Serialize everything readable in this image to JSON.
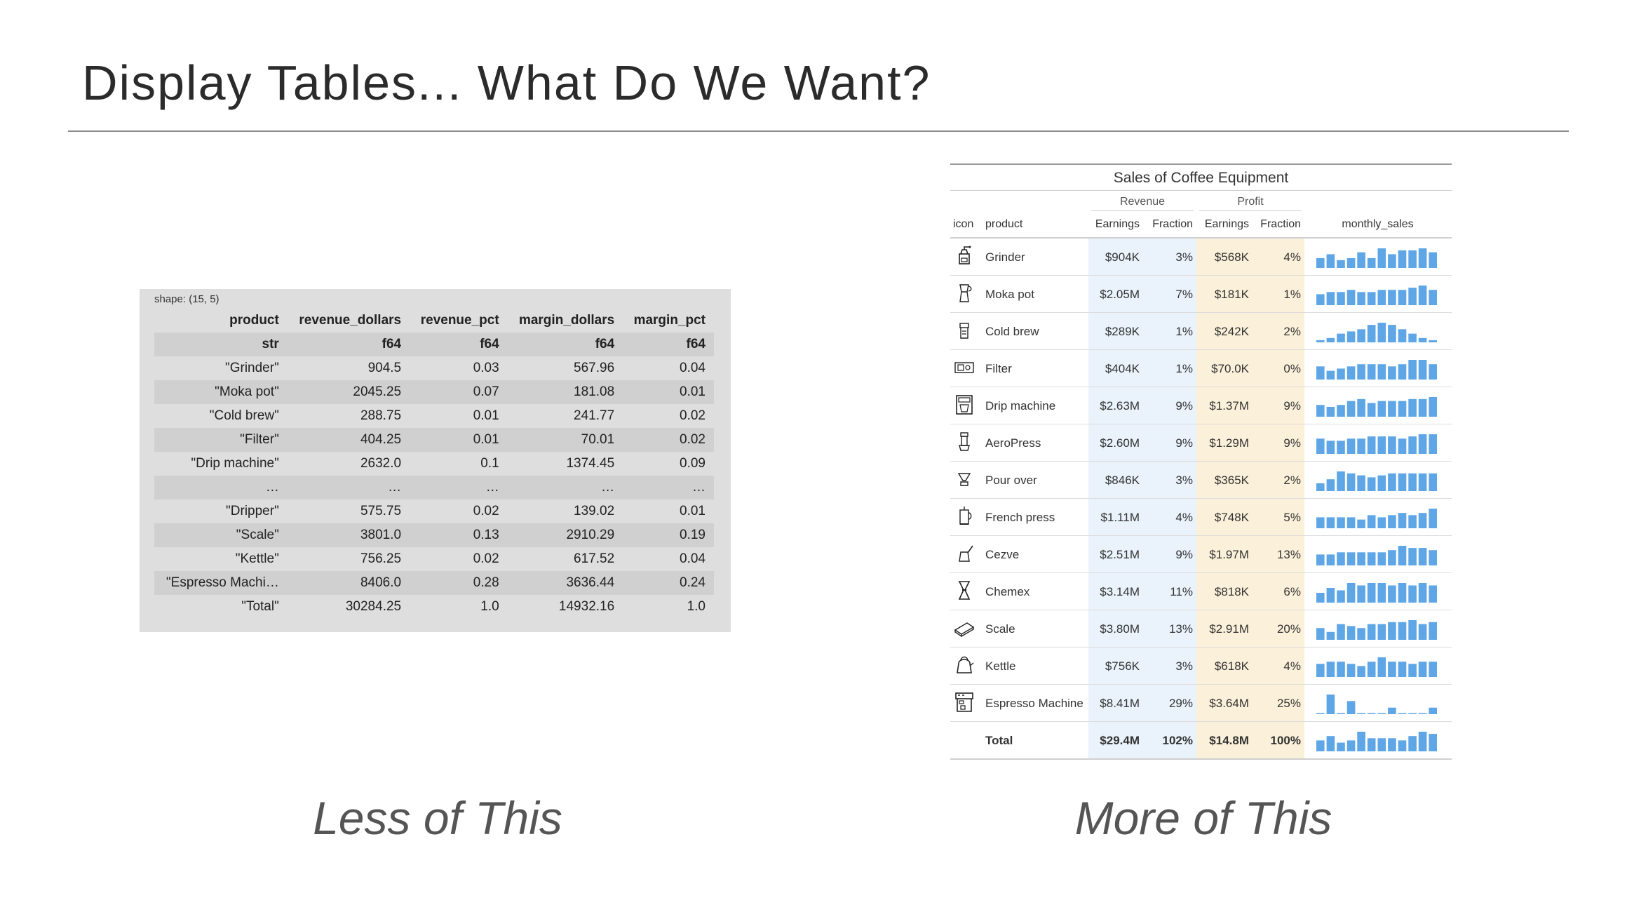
{
  "slide": {
    "title": "Display Tables... What Do We Want?",
    "left_caption": "Less of This",
    "right_caption": "More of This"
  },
  "dataframe": {
    "shape_text": "shape: (15, 5)",
    "columns": [
      "product",
      "revenue_dollars",
      "revenue_pct",
      "margin_dollars",
      "margin_pct"
    ],
    "dtypes": [
      "str",
      "f64",
      "f64",
      "f64",
      "f64"
    ],
    "rows": [
      [
        "\"Grinder\"",
        "904.5",
        "0.03",
        "567.96",
        "0.04"
      ],
      [
        "\"Moka pot\"",
        "2045.25",
        "0.07",
        "181.08",
        "0.01"
      ],
      [
        "\"Cold brew\"",
        "288.75",
        "0.01",
        "241.77",
        "0.02"
      ],
      [
        "\"Filter\"",
        "404.25",
        "0.01",
        "70.01",
        "0.02"
      ],
      [
        "\"Drip machine\"",
        "2632.0",
        "0.1",
        "1374.45",
        "0.09"
      ],
      [
        "…",
        "…",
        "…",
        "…",
        "…"
      ],
      [
        "\"Dripper\"",
        "575.75",
        "0.02",
        "139.02",
        "0.01"
      ],
      [
        "\"Scale\"",
        "3801.0",
        "0.13",
        "2910.29",
        "0.19"
      ],
      [
        "\"Kettle\"",
        "756.25",
        "0.02",
        "617.52",
        "0.04"
      ],
      [
        "\"Espresso Machi…",
        "8406.0",
        "0.28",
        "3636.44",
        "0.24"
      ],
      [
        "\"Total\"",
        "30284.25",
        "1.0",
        "14932.16",
        "1.0"
      ]
    ]
  },
  "gt": {
    "title": "Sales of Coffee Equipment",
    "spanner_revenue": "Revenue",
    "spanner_profit": "Profit",
    "col_icon": "icon",
    "col_product": "product",
    "col_rev_earnings": "Earnings",
    "col_rev_fraction": "Fraction",
    "col_prof_earnings": "Earnings",
    "col_prof_fraction": "Fraction",
    "col_monthly": "monthly_sales",
    "colors": {
      "revenue_band": "#eaf3fb",
      "profit_band": "#fbf0d9",
      "spark_bar": "#5ea6e6"
    },
    "rows": [
      {
        "icon": "grinder-icon",
        "product": "Grinder",
        "rev": "$904K",
        "rev_frac": "3%",
        "prof": "$568K",
        "prof_frac": "4%",
        "monthly": [
          5,
          7,
          4,
          5,
          8,
          5,
          10,
          7,
          9,
          9,
          10,
          8
        ]
      },
      {
        "icon": "moka-pot-icon",
        "product": "Moka pot",
        "rev": "$2.05M",
        "rev_frac": "7%",
        "prof": "$181K",
        "prof_frac": "1%",
        "monthly": [
          5,
          6,
          6,
          7,
          6,
          6,
          7,
          7,
          7,
          8,
          9,
          7
        ]
      },
      {
        "icon": "cold-brew-icon",
        "product": "Cold brew",
        "rev": "$289K",
        "rev_frac": "1%",
        "prof": "$242K",
        "prof_frac": "2%",
        "monthly": [
          1,
          2,
          4,
          5,
          6,
          8,
          9,
          8,
          6,
          4,
          2,
          1
        ]
      },
      {
        "icon": "filter-icon",
        "product": "Filter",
        "rev": "$404K",
        "rev_frac": "1%",
        "prof": "$70.0K",
        "prof_frac": "0%",
        "monthly": [
          6,
          4,
          5,
          6,
          7,
          7,
          7,
          6,
          7,
          9,
          9,
          7
        ]
      },
      {
        "icon": "drip-machine-icon",
        "product": "Drip machine",
        "rev": "$2.63M",
        "rev_frac": "9%",
        "prof": "$1.37M",
        "prof_frac": "9%",
        "monthly": [
          6,
          5,
          6,
          8,
          9,
          7,
          8,
          8,
          8,
          9,
          9,
          10
        ]
      },
      {
        "icon": "aeropress-icon",
        "product": "AeroPress",
        "rev": "$2.60M",
        "rev_frac": "9%",
        "prof": "$1.29M",
        "prof_frac": "9%",
        "monthly": [
          7,
          6,
          6,
          7,
          7,
          8,
          8,
          8,
          7,
          8,
          9,
          9
        ]
      },
      {
        "icon": "pour-over-icon",
        "product": "Pour over",
        "rev": "$846K",
        "rev_frac": "3%",
        "prof": "$365K",
        "prof_frac": "2%",
        "monthly": [
          4,
          6,
          10,
          9,
          8,
          7,
          8,
          9,
          9,
          9,
          9,
          9
        ]
      },
      {
        "icon": "french-press-icon",
        "product": "French press",
        "rev": "$1.11M",
        "rev_frac": "4%",
        "prof": "$748K",
        "prof_frac": "5%",
        "monthly": [
          5,
          5,
          5,
          5,
          4,
          6,
          5,
          6,
          7,
          6,
          7,
          9
        ]
      },
      {
        "icon": "cezve-icon",
        "product": "Cezve",
        "rev": "$2.51M",
        "rev_frac": "9%",
        "prof": "$1.97M",
        "prof_frac": "13%",
        "monthly": [
          5,
          5,
          6,
          6,
          6,
          6,
          6,
          7,
          9,
          8,
          8,
          7
        ]
      },
      {
        "icon": "chemex-icon",
        "product": "Chemex",
        "rev": "$3.14M",
        "rev_frac": "11%",
        "prof": "$818K",
        "prof_frac": "6%",
        "monthly": [
          4,
          6,
          5,
          8,
          7,
          8,
          8,
          7,
          8,
          7,
          8,
          7
        ]
      },
      {
        "icon": "scale-icon",
        "product": "Scale",
        "rev": "$3.80M",
        "rev_frac": "13%",
        "prof": "$2.91M",
        "prof_frac": "20%",
        "monthly": [
          6,
          4,
          8,
          7,
          6,
          8,
          8,
          9,
          9,
          10,
          8,
          9
        ]
      },
      {
        "icon": "kettle-icon",
        "product": "Kettle",
        "rev": "$756K",
        "rev_frac": "3%",
        "prof": "$618K",
        "prof_frac": "4%",
        "monthly": [
          6,
          7,
          7,
          6,
          5,
          7,
          9,
          7,
          7,
          6,
          7,
          7
        ]
      },
      {
        "icon": "espresso-machine-icon",
        "product": "Espresso Machine",
        "rev": "$8.41M",
        "rev_frac": "29%",
        "prof": "$3.64M",
        "prof_frac": "25%",
        "monthly": [
          0,
          9,
          0,
          6,
          0,
          0,
          0,
          3,
          0,
          0,
          0,
          3
        ]
      }
    ],
    "total": {
      "product": "Total",
      "rev": "$29.4M",
      "rev_frac": "102%",
      "prof": "$14.8M",
      "prof_frac": "100%",
      "monthly": [
        5,
        7,
        4,
        5,
        9,
        6,
        6,
        6,
        5,
        7,
        9,
        8
      ]
    }
  }
}
